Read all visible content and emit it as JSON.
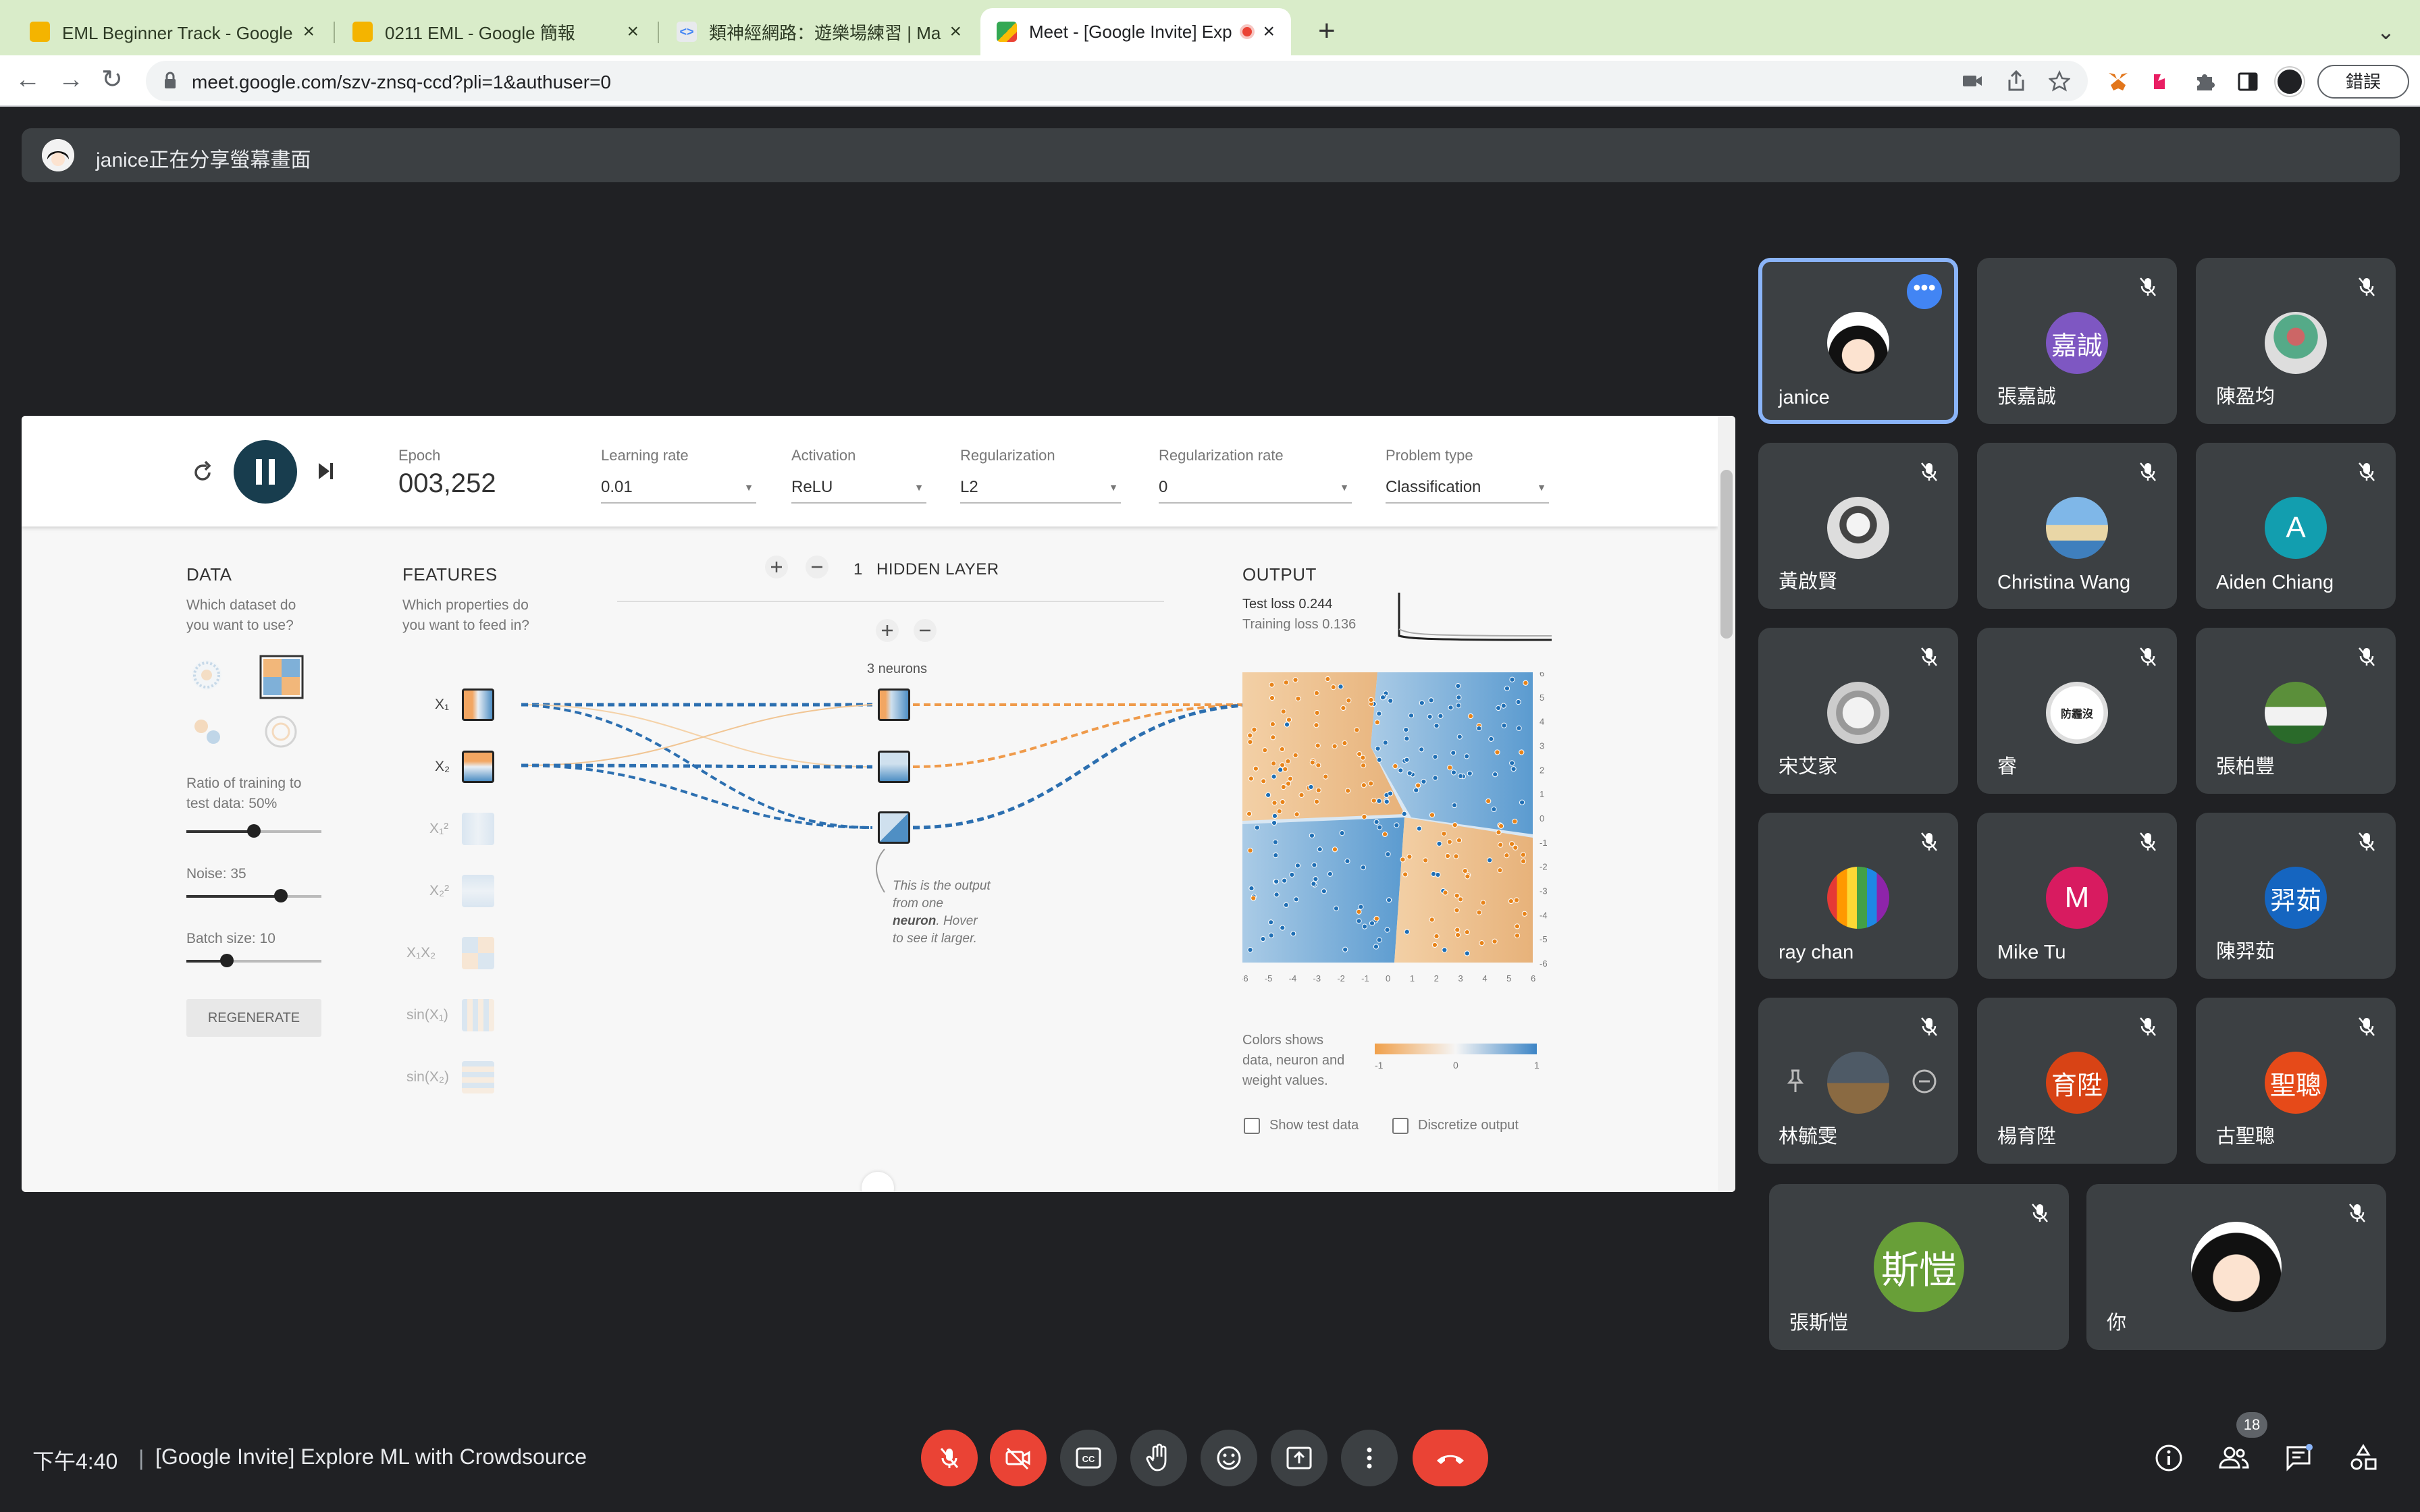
{
  "browser": {
    "tabs": [
      {
        "title": "EML Beginner Track - Google 簡",
        "icon": "google-slides-favicon",
        "active": false
      },
      {
        "title": "0211 EML - Google 簡報",
        "icon": "google-slides-favicon",
        "active": false
      },
      {
        "title": "類神經網路：遊樂場練習 | Machine Learning",
        "icon": "code-favicon",
        "active": false
      },
      {
        "title": "Meet - [Google Invite] Explore ML",
        "icon": "google-meet-favicon",
        "active": true,
        "recording": true
      }
    ],
    "url": "meet.google.com/szv-znsq-ccd?pli=1&authuser=0",
    "error_button": "錯誤"
  },
  "share_banner": {
    "text": "janice正在分享螢幕畫面"
  },
  "playground": {
    "epoch_label": "Epoch",
    "epoch_value": "003,252",
    "controls": [
      {
        "label": "Learning rate",
        "value": "0.01"
      },
      {
        "label": "Activation",
        "value": "ReLU"
      },
      {
        "label": "Regularization",
        "value": "L2"
      },
      {
        "label": "Regularization rate",
        "value": "0"
      },
      {
        "label": "Problem type",
        "value": "Classification"
      }
    ],
    "data": {
      "heading": "DATA",
      "subtitle_1": "Which dataset do",
      "subtitle_2": "you want to use?",
      "ratio_label_1": "Ratio of training to",
      "ratio_label_2": "test data:  50%",
      "ratio_value": 0.5,
      "noise_label": "Noise:  35",
      "noise_value": 0.7,
      "batch_label": "Batch size:  10",
      "batch_value": 0.3,
      "regenerate": "REGENERATE"
    },
    "features": {
      "heading": "FEATURES",
      "subtitle_1": "Which properties do",
      "subtitle_2": "you want to feed in?",
      "items": [
        {
          "label": "X₁",
          "active": true
        },
        {
          "label": "X₂",
          "active": true
        },
        {
          "label": "X₁²",
          "active": false
        },
        {
          "label": "X₂²",
          "active": false
        },
        {
          "label": "X₁X₂",
          "active": false
        },
        {
          "label": "sin(X₁)",
          "active": false
        },
        {
          "label": "sin(X₂)",
          "active": false
        }
      ]
    },
    "hidden": {
      "count": "1",
      "heading": "HIDDEN LAYER",
      "neurons_label": "3 neurons",
      "tooltip_1": "This is the output",
      "tooltip_2": "from one",
      "tooltip_3": "neuron",
      "tooltip_4": ". Hover",
      "tooltip_5": "to see it larger."
    },
    "output": {
      "heading": "OUTPUT",
      "test_loss": "Test loss 0.244",
      "training_loss": "Training loss 0.136",
      "colors_1": "Colors shows",
      "colors_2": "data, neuron and",
      "colors_3": "weight values.",
      "show_test": "Show test data",
      "discretize": "Discretize output",
      "x_ticks": [
        "-6",
        "-5",
        "-4",
        "-3",
        "-2",
        "-1",
        "0",
        "1",
        "2",
        "3",
        "4",
        "5",
        "6"
      ],
      "y_ticks": [
        "6",
        "5",
        "4",
        "3",
        "2",
        "1",
        "0",
        "-1",
        "-2",
        "-3",
        "-4",
        "-5",
        "-6"
      ],
      "scale_ticks": [
        "-1",
        "0",
        "1"
      ]
    }
  },
  "participants": [
    {
      "name": "janice",
      "type": "photo",
      "speaking": true
    },
    {
      "name": "張嘉誠",
      "initial": "嘉誠",
      "color": "#7e57c2"
    },
    {
      "name": "陳盈均",
      "type": "photo"
    },
    {
      "name": "黃啟賢",
      "type": "photo"
    },
    {
      "name": "Christina Wang",
      "type": "photo"
    },
    {
      "name": "Aiden Chiang",
      "initial": "A",
      "color": "#129eaf"
    },
    {
      "name": "宋艾家",
      "type": "photo"
    },
    {
      "name": "睿",
      "type": "photo",
      "badge": "防霾沒"
    },
    {
      "name": "張柏豐",
      "type": "photo"
    },
    {
      "name": "ray chan",
      "type": "photo"
    },
    {
      "name": "Mike Tu",
      "initial": "M",
      "color": "#d81b60"
    },
    {
      "name": "陳羿茹",
      "initial": "羿茹",
      "color": "#1565c0"
    },
    {
      "name": "林毓雯",
      "type": "photo"
    },
    {
      "name": "楊育陞",
      "initial": "育陞",
      "color": "#d84315"
    },
    {
      "name": "古聖聰",
      "initial": "聖聰",
      "color": "#e64a19"
    },
    {
      "name": "張斯愷",
      "initial": "斯愷",
      "color": "#689f38"
    },
    {
      "name": "你",
      "type": "photo"
    }
  ],
  "bottom": {
    "time": "下午4:40",
    "separator": "|",
    "meeting_title": "[Google Invite] Explore ML with Crowdsource",
    "participant_count": "18"
  }
}
